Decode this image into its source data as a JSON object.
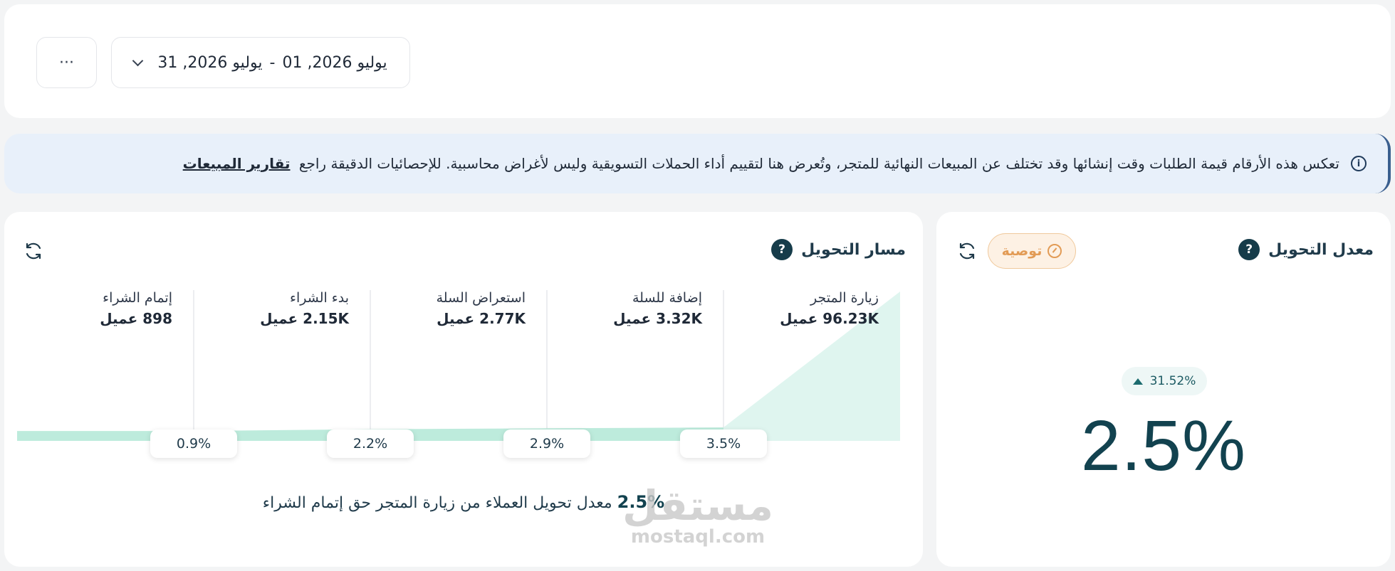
{
  "toolbar": {
    "more_label": "···",
    "date_from": "يوليو 2026, 01",
    "date_separator": "-",
    "date_to": "يوليو 2026, 31"
  },
  "banner": {
    "text": "تعكس هذه الأرقام قيمة الطلبات وقت إنشائها وقد تختلف عن المبيعات النهائية للمتجر، وتُعرض هنا لتقييم أداء الحملات التسويقية وليس لأغراض محاسبية. للإحصائيات الدقيقة راجع",
    "link": "تقارير المبيعات"
  },
  "conversion_rate": {
    "title": "معدل التحويل",
    "badge": "توصية",
    "change": "31.52%",
    "value": "2.5%"
  },
  "funnel": {
    "title": "مسار التحويل",
    "stages": [
      {
        "name": "زيارة المتجر",
        "count": "96.23K عميل",
        "value": 96230
      },
      {
        "name": "إضافة للسلة",
        "count": "3.32K عميل",
        "value": 3320
      },
      {
        "name": "استعراض السلة",
        "count": "2.77K عميل",
        "value": 2770
      },
      {
        "name": "بدء الشراء",
        "count": "2.15K عميل",
        "value": 2150
      },
      {
        "name": "إتمام الشراء",
        "count": "898 عميل",
        "value": 898
      }
    ],
    "rates": [
      "3.5%",
      "2.9%",
      "2.2%",
      "0.9%"
    ],
    "summary_pct": "2.5%",
    "summary_text": "معدل تحويل العملاء من زيارة المتجر حق إتمام الشراء"
  },
  "colors": {
    "accent": "#12424f",
    "fill": "#dff5ef",
    "fill_strong": "#bdebdc",
    "badge": "#e29b55"
  },
  "watermark": {
    "arabic": "مستقل",
    "latin": "mostaql.com"
  }
}
